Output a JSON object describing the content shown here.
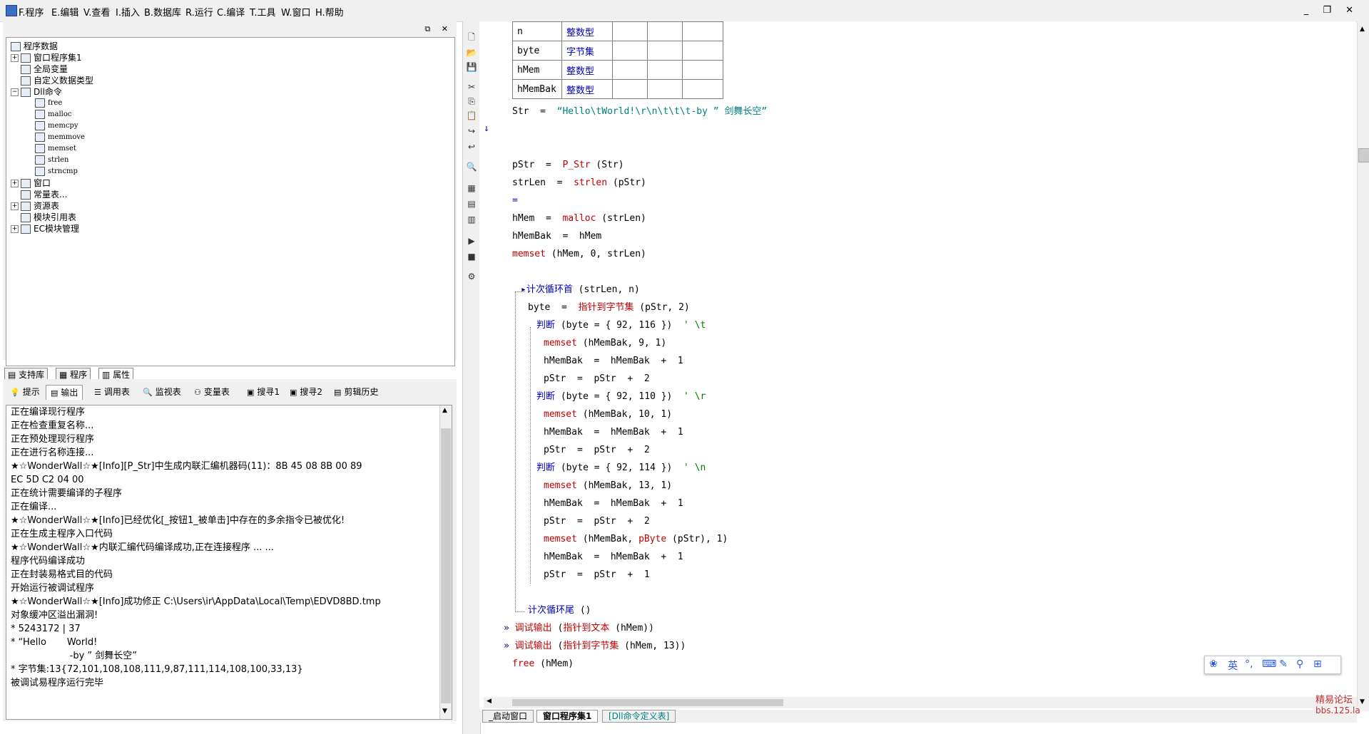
{
  "menu": {
    "items": [
      "F.程序",
      "E.编辑",
      "V.查看",
      "I.插入",
      "B.数据库",
      "R.运行",
      "C.编译",
      "T.工具",
      "W.窗口",
      "H.帮助"
    ]
  },
  "window_controls": "_ ❐ ✕",
  "tree": {
    "root": "程序数据",
    "items": [
      {
        "label": "窗口程序集1"
      },
      {
        "label": "全局变量"
      },
      {
        "label": "自定义数据类型"
      },
      {
        "label": "Dll命令"
      },
      {
        "label": "free"
      },
      {
        "label": "malloc"
      },
      {
        "label": "memcpy"
      },
      {
        "label": "memmove"
      },
      {
        "label": "memset"
      },
      {
        "label": "strlen"
      },
      {
        "label": "strncmp"
      },
      {
        "label": "窗口"
      },
      {
        "label": "常量表..."
      },
      {
        "label": "资源表"
      },
      {
        "label": "模块引用表"
      },
      {
        "label": "EC模块管理"
      }
    ]
  },
  "left_tabs": [
    "支持库",
    "程序",
    "属性"
  ],
  "bottom_tabs": [
    "提示",
    "输出",
    "调用表",
    "监视表",
    "变量表",
    "搜寻1",
    "搜寻2",
    "剪辑历史"
  ],
  "output_lines": [
    "正在编译现行程序",
    "正在检查重复名称...",
    "正在预处理现行程序",
    "正在进行名称连接...",
    "★☆WonderWall☆★[Info][P_Str]中生成内联汇编机器码(11)：8B 45 08 8B 00 89",
    "EC 5D C2 04 00",
    "正在统计需要编译的子程序",
    "正在编译...",
    "★☆WonderWall☆★[Info]已经优化[_按钮1_被单击]中存在的多余指令已被优化!",
    "正在生成主程序入口代码",
    "★☆WonderWall☆★内联汇编代码编译成功,正在连接程序 ... ...",
    "程序代码编译成功",
    "正在封装易格式目的代码",
    "开始运行被调试程序",
    "★☆WonderWall☆★[Info]成功修正 C:\\Users\\ir\\AppData\\Local\\Temp\\EDVD8BD.tmp",
    "对象缓冲区溢出漏洞!",
    "* 5243172 | 37",
    "* “Hello       World!",
    "                    -by ” 剑舞长空”",
    "* 字节集:13{72,101,108,108,111,9,87,111,114,108,100,33,13}",
    "被调试易程序运行完毕"
  ],
  "var_table": [
    {
      "name": "n",
      "type": "整数型"
    },
    {
      "name": "byte",
      "type": "字节集"
    },
    {
      "name": "hMem",
      "type": "整数型"
    },
    {
      "name": "hMemBak",
      "type": "整数型"
    }
  ],
  "code": {
    "str_line": {
      "lhs": "Str",
      "op": "=",
      "value": "“Hello\\tWorld!\\r\\n\\t\\t\\t-by ” 剑舞长空”"
    },
    "l_pstr": {
      "lhs": "pStr",
      "fn": "P_Str",
      "args": "(Str)"
    },
    "l_strlen": {
      "lhs": "strLen",
      "fn": "strlen",
      "args": "(pStr)"
    },
    "l_eq": "=",
    "l_hmem": {
      "lhs": "hMem",
      "fn": "malloc",
      "args": "(strLen)"
    },
    "l_hmembak": "hMemBak  =  hMem",
    "l_memset1": {
      "fn": "memset",
      "args": "(hMem, 0, strLen)"
    },
    "loop_head": {
      "kw": "计次循环首",
      "args": "(strLen, n)"
    },
    "l_byte": {
      "lhs": "byte",
      "fn": "指针到字节集",
      "args": "(pStr, 2)"
    },
    "if1": {
      "kw": "判断",
      "args": "(byte = { 92, 116 })",
      "cmt": "' \\t"
    },
    "m1": {
      "fn": "memset",
      "args": "(hMemBak, 9, 1)"
    },
    "inc1": "hMemBak  =  hMemBak  +  1",
    "p1": "pStr  =  pStr  +  2",
    "if2": {
      "kw": "判断",
      "args": "(byte = { 92, 110 })",
      "cmt": "' \\r"
    },
    "m2": {
      "fn": "memset",
      "args": "(hMemBak, 10, 1)"
    },
    "inc2": "hMemBak  =  hMemBak  +  1",
    "p2": "pStr  =  pStr  +  2",
    "if3": {
      "kw": "判断",
      "args": "(byte = { 92, 114 })",
      "cmt": "' \\n"
    },
    "m3": {
      "fn": "memset",
      "args": "(hMemBak, 13, 1)"
    },
    "inc3": "hMemBak  =  hMemBak  +  1",
    "p3": "pStr  =  pStr  +  2",
    "m4": {
      "fn": "memset",
      "args": "(hMemBak,",
      "inner_fn": "pByte",
      "inner_args": "(pStr), 1)"
    },
    "inc4": "hMemBak  =  hMemBak  +  1",
    "p4": "pStr  =  pStr  +  1",
    "loop_tail": {
      "kw": "计次循环尾",
      "args": "()"
    },
    "dbg1": {
      "fn": "调试输出",
      "inner_fn": "指针到文本",
      "args": "(hMem))"
    },
    "dbg2": {
      "fn": "调试输出",
      "inner_fn": "指针到字节集",
      "args": "(hMem, 13))"
    },
    "free": {
      "fn": "free",
      "args": "(hMem)"
    }
  },
  "code_tabs": [
    "_启动窗口",
    "窗口程序集1",
    "[Dll命令定义表]"
  ],
  "ime": [
    "英"
  ],
  "watermark": {
    "line1": "精易论坛",
    "line2": "bbs.125.la"
  },
  "colors": {
    "keyword": "#0000c0",
    "function": "#c00000",
    "string": "#008080",
    "comment": "#008000"
  }
}
